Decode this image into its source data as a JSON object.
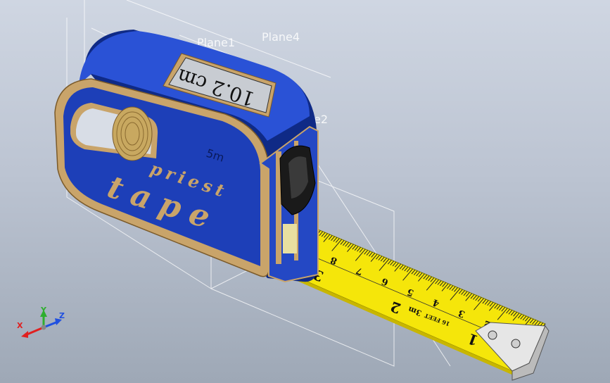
{
  "viewport": {
    "background_top": "#cfd6e2",
    "background_bottom": "#9ea8b6"
  },
  "planes": [
    {
      "id": "plane1",
      "label": "Plane1"
    },
    {
      "id": "plane4",
      "label": "Plane4"
    },
    {
      "id": "plane2",
      "label": "Plane2"
    }
  ],
  "model": {
    "display_reading": "10.2 cm",
    "size_label": "5m",
    "brand_line1": "priest",
    "brand_line2": "tape",
    "housing_color": "#1d3fb8",
    "trim_color": "#c9a46a",
    "tape_color": "#f5e60a"
  },
  "tape": {
    "cm_labels": [
      "9",
      "8",
      "7",
      "6",
      "5",
      "4",
      "3",
      "2",
      "1"
    ],
    "inch_labels": [
      "3",
      "2",
      "1"
    ],
    "small_marks": [
      "3m",
      "16 FEET"
    ]
  },
  "triad": {
    "x": "X",
    "y": "Y",
    "z": "Z",
    "x_color": "#e02020",
    "y_color": "#2fae2f",
    "z_color": "#2050e0"
  }
}
